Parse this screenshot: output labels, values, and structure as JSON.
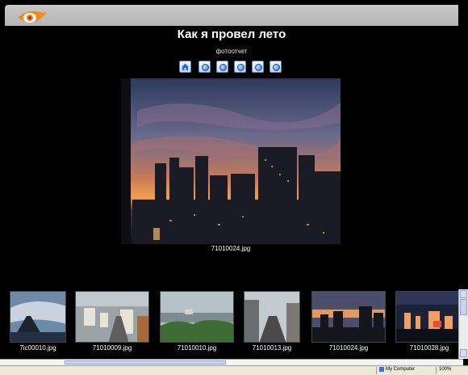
{
  "header": {
    "title": "Как я провел лето",
    "subtitle": "фотоотчет",
    "logo": "eye-logo"
  },
  "nav_icons": [
    "home-icon",
    "first-icon",
    "previous-icon",
    "slideshow-icon",
    "next-icon",
    "last-icon"
  ],
  "main_photo": {
    "caption": "71010024.jpg"
  },
  "thumbnails": [
    {
      "caption": "7ic00010.jpg"
    },
    {
      "caption": "71010009.jpg"
    },
    {
      "caption": "71010010.jpg"
    },
    {
      "caption": "71010013.jpg"
    },
    {
      "caption": "71010024.jpg"
    },
    {
      "caption": "71010028.jpg"
    }
  ],
  "status_bar": {
    "zone": "My Computer",
    "zoom": "100%"
  },
  "colors": {
    "background": "#000000",
    "header_bar": "#c0c0c0",
    "logo_orange": "#f08a1e"
  }
}
